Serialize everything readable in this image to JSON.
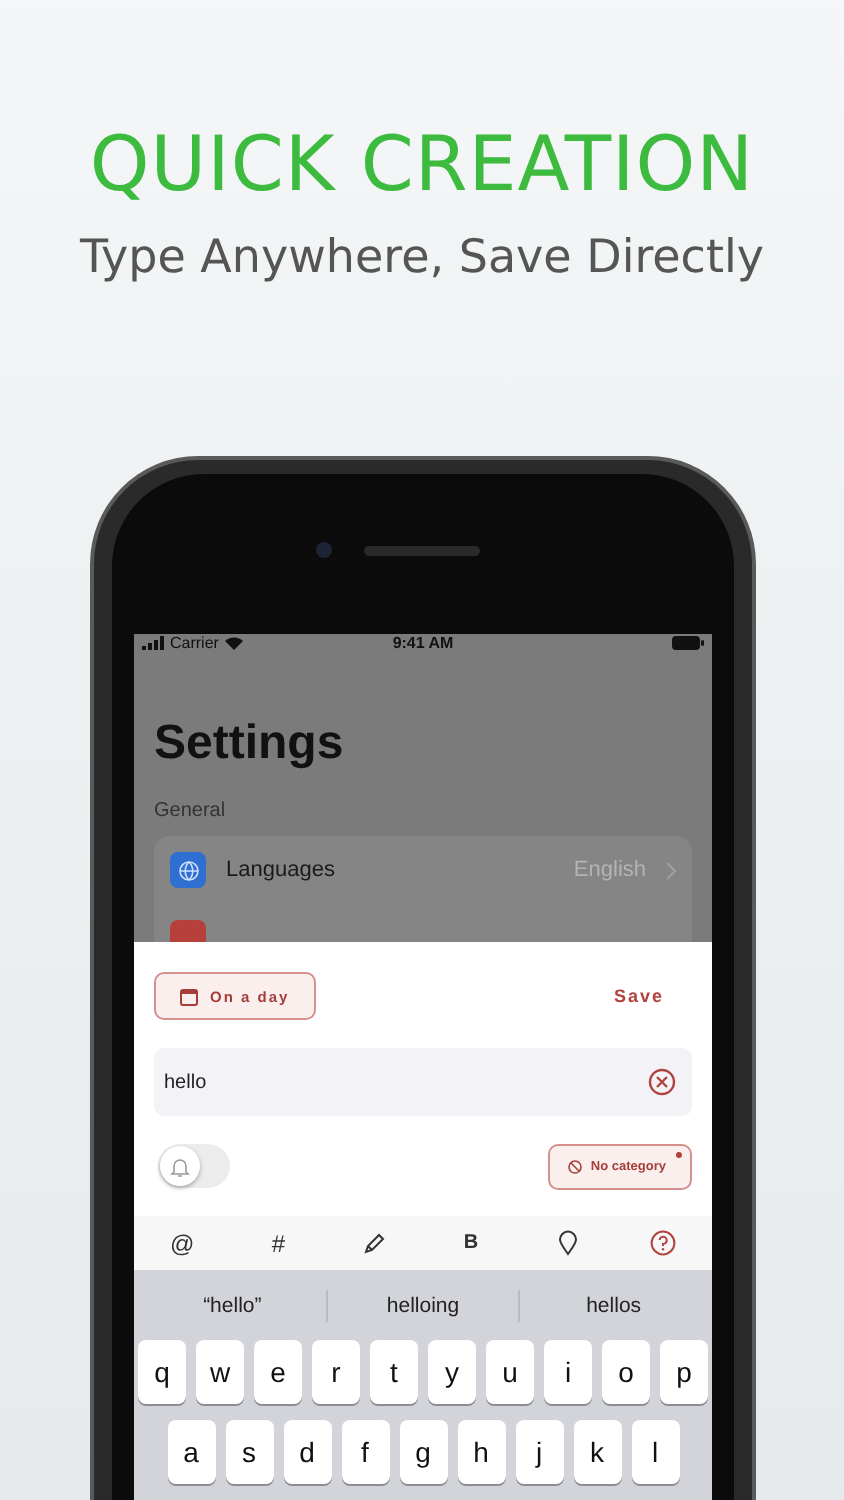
{
  "headline": "QUICK CREATION",
  "subheadline": "Type Anywhere, Save Directly",
  "status_bar": {
    "carrier": "Carrier",
    "time": "9:41 AM"
  },
  "settings": {
    "title": "Settings",
    "section": "General",
    "rows": [
      {
        "label": "Languages",
        "value": "English",
        "color": "#2f6fd1"
      },
      {
        "color": "#b8403a"
      }
    ]
  },
  "sheet": {
    "date_button": "On a day",
    "save": "Save",
    "input": {
      "value": "hello"
    },
    "reminder": {
      "on": false
    },
    "category": {
      "label": "No category"
    }
  },
  "toolbar": [
    {
      "kind": "text",
      "label": "@"
    },
    {
      "kind": "text",
      "label": "#"
    },
    {
      "kind": "pencil"
    },
    {
      "kind": "bold",
      "label": "B"
    },
    {
      "kind": "pin"
    },
    {
      "kind": "help"
    }
  ],
  "suggestions": [
    "“hello”",
    "helloing",
    "hellos"
  ],
  "keyboard": [
    [
      "q",
      "w",
      "e",
      "r",
      "t",
      "y",
      "u",
      "i",
      "o",
      "p"
    ],
    [
      "a",
      "s",
      "d",
      "f",
      "g",
      "h",
      "j",
      "k",
      "l"
    ]
  ]
}
